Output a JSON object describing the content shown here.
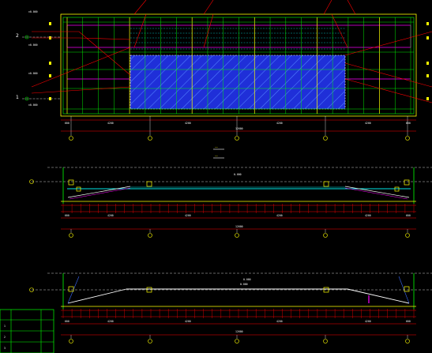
{
  "colors": {
    "background": "#000000",
    "grid_yellow": "#ffff00",
    "grid_green": "#00ff00",
    "leader_red": "#ff0000",
    "panel_magenta": "#ff00ff",
    "hatch_blue": "#1f2fd8",
    "hatch_line": "#3a6bff",
    "beam_cyan": "#00e5e5",
    "text_white": "#ffffff",
    "dim_green": "#1fd11f"
  },
  "plan": {
    "row_markers": [
      "2",
      "1"
    ],
    "level_labels": [
      "±0.000",
      "±0.000",
      "±0.000",
      "±0.000"
    ],
    "column_markers": [
      "",
      "",
      "",
      "",
      "",
      ""
    ],
    "dimension_values": [
      "600",
      "4200",
      "4200",
      "4200",
      "4200",
      "600"
    ],
    "overall_dimension": "12600"
  },
  "legend": {
    "items": [
      "——",
      "——"
    ]
  },
  "section_a": {
    "axis_marker": "",
    "title": "0.000",
    "dimension_values": [
      "600",
      "4200",
      "4200",
      "4200",
      "4200",
      "600"
    ],
    "overall_dimension": "12600"
  },
  "section_b": {
    "titles": [
      "0.000",
      "0.000"
    ],
    "dimension_values": [
      "600",
      "4200",
      "4200",
      "4200",
      "4200",
      "600"
    ],
    "overall_dimension": "12600"
  },
  "schedule_table": {
    "headers": [
      "",
      "",
      ""
    ],
    "rows": [
      [
        "1",
        "",
        ""
      ],
      [
        "2",
        "",
        ""
      ],
      [
        "3",
        "",
        ""
      ]
    ]
  }
}
